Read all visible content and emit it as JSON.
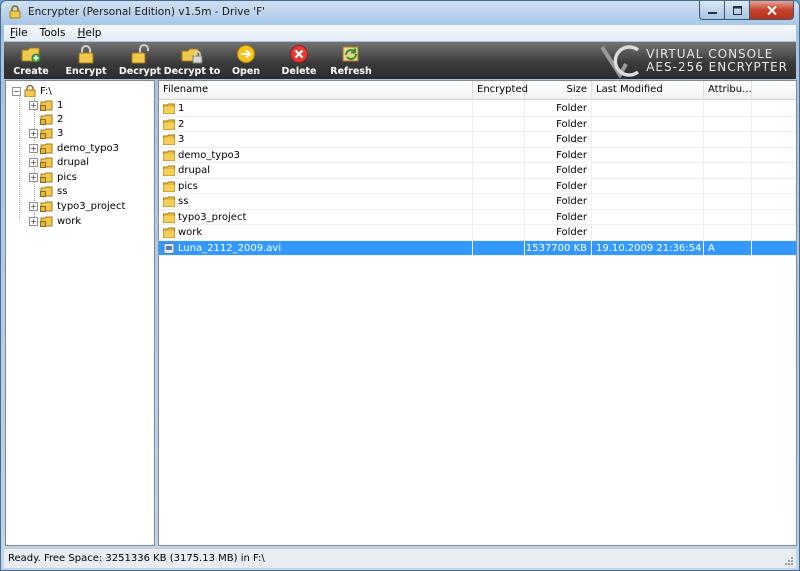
{
  "window": {
    "title": "Encrypter (Personal Edition) v1.5m - Drive 'F'"
  },
  "menu": [
    {
      "label": "File",
      "accel": "F",
      "rest": "ile"
    },
    {
      "label": "Tools",
      "accel": "",
      "rest": "Tools"
    },
    {
      "label": "Help",
      "accel": "H",
      "rest": "elp"
    }
  ],
  "toolbar": {
    "buttons": [
      {
        "id": "create",
        "label": "Create",
        "icon": "folder-new-icon"
      },
      {
        "id": "encrypt",
        "label": "Encrypt",
        "icon": "lock-closed-icon"
      },
      {
        "id": "decrypt",
        "label": "Decrypt",
        "icon": "lock-open-icon"
      },
      {
        "id": "decrypt-to",
        "label": "Decrypt to",
        "icon": "folder-lock-icon"
      },
      {
        "id": "open",
        "label": "Open",
        "icon": "arrow-right-circle-icon"
      },
      {
        "id": "delete",
        "label": "Delete",
        "icon": "delete-x-icon"
      },
      {
        "id": "refresh",
        "label": "Refresh",
        "icon": "refresh-icon"
      }
    ],
    "brand_line1": "VIRTUAL CONSOLE",
    "brand_line2": "AES-256 ENCRYPTER"
  },
  "tree": {
    "root": "F:\\",
    "items": [
      {
        "label": "1",
        "expandable": true
      },
      {
        "label": "2",
        "expandable": false
      },
      {
        "label": "3",
        "expandable": true
      },
      {
        "label": "demo_typo3",
        "expandable": true
      },
      {
        "label": "drupal",
        "expandable": true
      },
      {
        "label": "pics",
        "expandable": true
      },
      {
        "label": "ss",
        "expandable": false
      },
      {
        "label": "typo3_project",
        "expandable": true
      },
      {
        "label": "work",
        "expandable": true
      }
    ]
  },
  "list": {
    "columns": [
      "Filename",
      "Encrypted",
      "Size",
      "Last Modified",
      "Attribu..."
    ],
    "rows": [
      {
        "name": "1",
        "type": "folder",
        "encrypted": "",
        "size": "Folder",
        "modified": "",
        "attr": ""
      },
      {
        "name": "2",
        "type": "folder",
        "encrypted": "",
        "size": "Folder",
        "modified": "",
        "attr": ""
      },
      {
        "name": "3",
        "type": "folder",
        "encrypted": "",
        "size": "Folder",
        "modified": "",
        "attr": ""
      },
      {
        "name": "demo_typo3",
        "type": "folder",
        "encrypted": "",
        "size": "Folder",
        "modified": "",
        "attr": ""
      },
      {
        "name": "drupal",
        "type": "folder",
        "encrypted": "",
        "size": "Folder",
        "modified": "",
        "attr": ""
      },
      {
        "name": "pics",
        "type": "folder",
        "encrypted": "",
        "size": "Folder",
        "modified": "",
        "attr": ""
      },
      {
        "name": "ss",
        "type": "folder",
        "encrypted": "",
        "size": "Folder",
        "modified": "",
        "attr": ""
      },
      {
        "name": "typo3_project",
        "type": "folder",
        "encrypted": "",
        "size": "Folder",
        "modified": "",
        "attr": ""
      },
      {
        "name": "work",
        "type": "folder",
        "encrypted": "",
        "size": "Folder",
        "modified": "",
        "attr": ""
      },
      {
        "name": "Luna_2112_2009.avi",
        "type": "file",
        "encrypted": "",
        "size": "1537700  KB",
        "modified": "19.10.2009   21:36:54",
        "attr": "A",
        "selected": true
      }
    ]
  },
  "status": {
    "text": "Ready.   Free Space: 3251336 KB (3175.13 MB) in F:\\"
  },
  "colors": {
    "selection": "#3399ff",
    "toolbar": "#3b3b3b",
    "folder": "#f2c84b"
  }
}
